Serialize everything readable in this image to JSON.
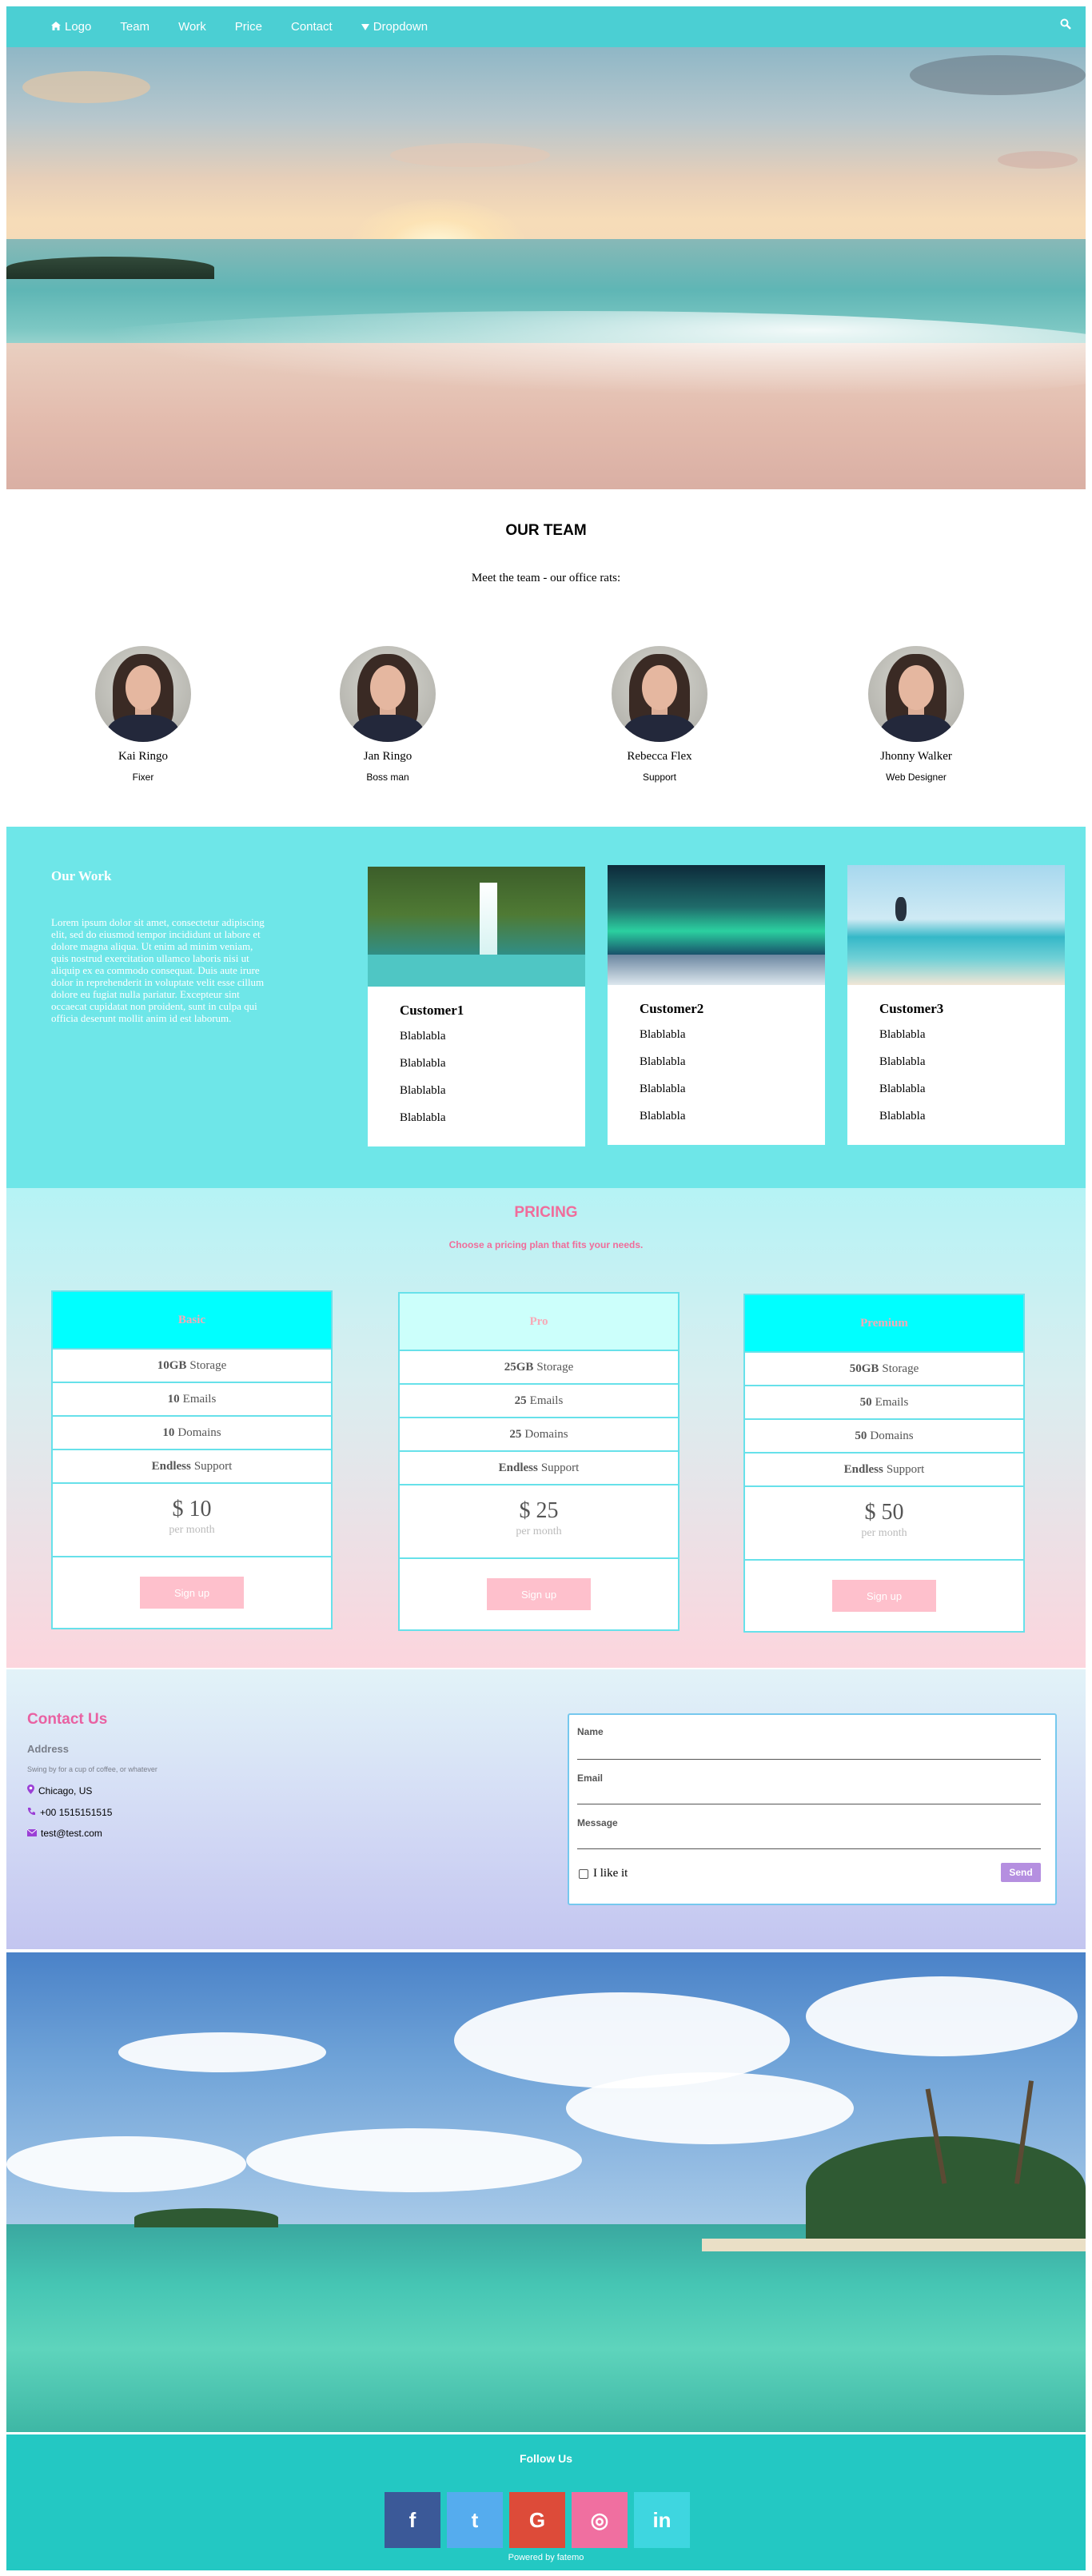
{
  "nav": {
    "items": [
      {
        "label": "Logo",
        "icon": "home-icon"
      },
      {
        "label": "Team"
      },
      {
        "label": "Work"
      },
      {
        "label": "Price"
      },
      {
        "label": "Contact"
      },
      {
        "label": "Dropdown",
        "icon": "caret-down-icon"
      }
    ],
    "search_icon": "search-icon",
    "background": "#4bcfd3"
  },
  "team": {
    "title": "OUR TEAM",
    "subtitle": "Meet the team - our office rats:",
    "members": [
      {
        "name": "Kai Ringo",
        "role": "Fixer"
      },
      {
        "name": "Jan Ringo",
        "role": "Boss man"
      },
      {
        "name": "Rebecca Flex",
        "role": "Support"
      },
      {
        "name": "Jhonny Walker",
        "role": "Web Designer"
      }
    ]
  },
  "work": {
    "title": "Our Work",
    "text": "Lorem ipsum dolor sit amet, consectetur adipiscing elit, sed do eiusmod tempor incididunt ut labore et dolore magna aliqua. Ut enim ad minim veniam, quis nostrud exercitation ullamco laboris nisi ut aliquip ex ea commodo consequat. Duis aute irure dolor in reprehenderit in voluptate velit esse cillum dolore eu fugiat nulla pariatur. Excepteur sint occaecat cupidatat non proident, sunt in culpa qui officia deserunt mollit anim id est laborum.",
    "background": "#6ee6e8",
    "cards": [
      {
        "title": "Customer1",
        "lines": [
          "Blablabla",
          "Blablabla",
          "Blablabla",
          "Blablabla"
        ]
      },
      {
        "title": "Customer2",
        "lines": [
          "Blablabla",
          "Blablabla",
          "Blablabla",
          "Blablabla"
        ]
      },
      {
        "title": "Customer3",
        "lines": [
          "Blablabla",
          "Blablabla",
          "Blablabla",
          "Blablabla"
        ]
      }
    ]
  },
  "pricing": {
    "title": "PRICING",
    "subtitle": "Choose a pricing plan that fits your needs.",
    "plans": [
      {
        "name": "Basic",
        "storage_b": "10GB",
        "storage": "Storage",
        "emails_b": "10",
        "emails": "Emails",
        "domains_b": "10",
        "domains": "Domains",
        "support_b": "Endless",
        "support": "Support",
        "price": "$ 10",
        "per": "per month",
        "button": "Sign up",
        "header_color": "#00ffff"
      },
      {
        "name": "Pro",
        "storage_b": "25GB",
        "storage": "Storage",
        "emails_b": "25",
        "emails": "Emails",
        "domains_b": "25",
        "domains": "Domains",
        "support_b": "Endless",
        "support": "Support",
        "price": "$ 25",
        "per": "per month",
        "button": "Sign up",
        "header_color": "#ccfffb"
      },
      {
        "name": "Premium",
        "storage_b": "50GB",
        "storage": "Storage",
        "emails_b": "50",
        "emails": "Emails",
        "domains_b": "50",
        "domains": "Domains",
        "support_b": "Endless",
        "support": "Support",
        "price": "$ 50",
        "per": "per month",
        "button": "Sign up",
        "header_color": "#00ffff"
      }
    ]
  },
  "contact": {
    "title": "Contact Us",
    "address_label": "Address",
    "note": "Swing by for a cup of coffee, or whatever",
    "city": "Chicago, US",
    "phone": "+00 1515151515",
    "email": "test@test.com",
    "form": {
      "name_label": "Name",
      "email_label": "Email",
      "message_label": "Message",
      "checkbox_label": "I like it",
      "send": "Send"
    }
  },
  "footer": {
    "title": "Follow Us",
    "socials": [
      {
        "icon": "facebook-icon",
        "glyph": "f",
        "color": "#3b5998"
      },
      {
        "icon": "twitter-icon",
        "glyph": "t",
        "color": "#55acee"
      },
      {
        "icon": "google-icon",
        "glyph": "G",
        "color": "#dd4b39"
      },
      {
        "icon": "instagram-icon",
        "glyph": "◎",
        "color": "#f06fa0"
      },
      {
        "icon": "linkedin-icon",
        "glyph": "in",
        "color": "#3ed6e0"
      }
    ],
    "powered": "Powered by fatemo",
    "background": "#23c8c3"
  }
}
